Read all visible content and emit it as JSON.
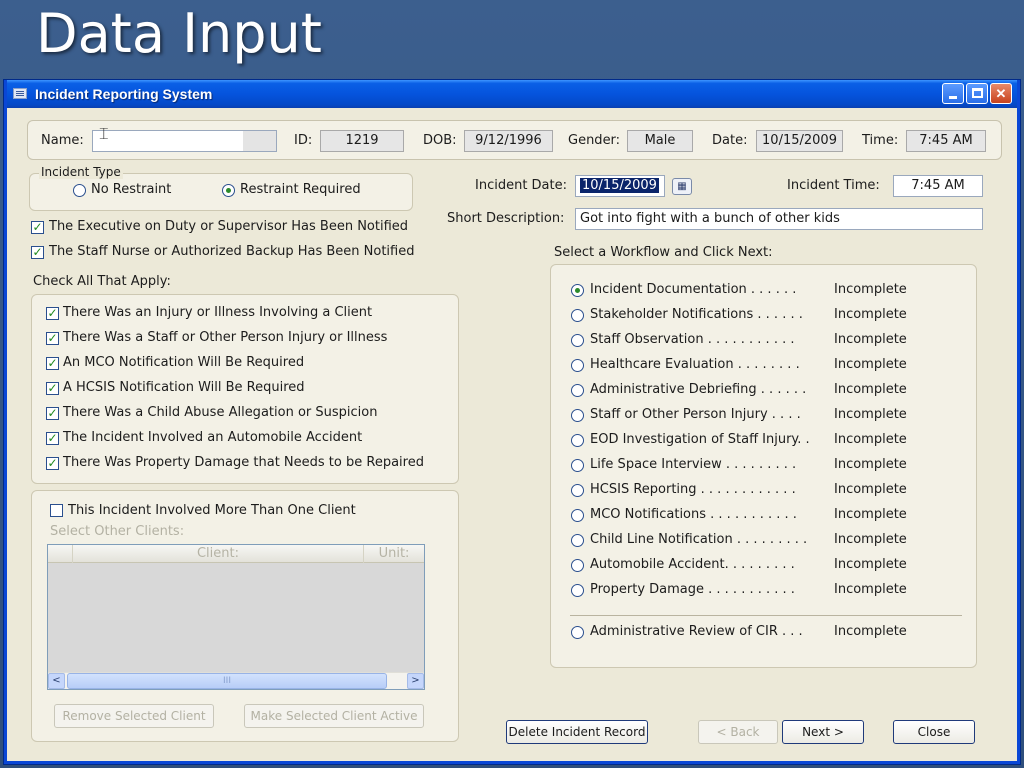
{
  "slide": {
    "title": "Data Input"
  },
  "window": {
    "title": "Incident Reporting System"
  },
  "header": {
    "name_label": "Name:",
    "name_value": "",
    "id_label": "ID:",
    "id_value": "1219",
    "dob_label": "DOB:",
    "dob_value": "9/12/1996",
    "gender_label": "Gender:",
    "gender_value": "Male",
    "date_label": "Date:",
    "date_value": "10/15/2009",
    "time_label": "Time:",
    "time_value": "7:45 AM"
  },
  "incident_type": {
    "legend": "Incident Type",
    "options": [
      {
        "label": "No Restraint",
        "selected": false
      },
      {
        "label": "Restraint Required",
        "selected": true
      }
    ]
  },
  "notifications": [
    {
      "label": "The Executive on Duty or Supervisor Has Been Notified",
      "checked": true
    },
    {
      "label": "The Staff Nurse or Authorized Backup Has Been Notified",
      "checked": true
    }
  ],
  "details": {
    "incident_date_label": "Incident Date:",
    "incident_date_value": "10/15/2009",
    "incident_time_label": "Incident Time:",
    "incident_time_value": "7:45 AM",
    "short_desc_label": "Short Description:",
    "short_desc_value": "Got into fight with a bunch of other kids"
  },
  "check_all": {
    "heading": "Check All That Apply:",
    "items": [
      {
        "label": "There Was an Injury or Illness Involving a Client",
        "checked": true
      },
      {
        "label": "There Was a Staff or Other Person Injury or Illness",
        "checked": true
      },
      {
        "label": "An MCO Notification Will Be Required",
        "checked": true
      },
      {
        "label": "A HCSIS Notification Will Be Required",
        "checked": true
      },
      {
        "label": "There Was a Child Abuse Allegation or Suspicion",
        "checked": true
      },
      {
        "label": "The Incident Involved an Automobile Accident",
        "checked": true
      },
      {
        "label": "There Was Property Damage that Needs to be Repaired",
        "checked": true
      }
    ]
  },
  "clients": {
    "more_than_one_label": "This Incident Involved More Than One Client",
    "more_than_one_checked": false,
    "select_other_label": "Select Other Clients:",
    "columns": [
      "Client:",
      "Unit:"
    ],
    "scroll_left": "<",
    "scroll_right": ">",
    "thumb_grip": "III",
    "remove_button": "Remove Selected Client",
    "make_active_button": "Make Selected Client Active"
  },
  "workflow": {
    "heading": "Select a Workflow and Click Next:",
    "items": [
      {
        "label": "Incident Documentation . . . . . .",
        "status": "Incomplete",
        "selected": true
      },
      {
        "label": "Stakeholder Notifications  . . . . . .",
        "status": "Incomplete",
        "selected": false
      },
      {
        "label": "Staff Observation . . . . . . . . . . .",
        "status": "Incomplete",
        "selected": false
      },
      {
        "label": "Healthcare Evaluation . . . . . . . .",
        "status": "Incomplete",
        "selected": false
      },
      {
        "label": "Administrative Debriefing . . . . . .",
        "status": "Incomplete",
        "selected": false
      },
      {
        "label": "Staff or Other Person Injury . . . .",
        "status": "Incomplete",
        "selected": false
      },
      {
        "label": "EOD Investigation of Staff Injury. .",
        "status": "Incomplete",
        "selected": false
      },
      {
        "label": "Life Space Interview . . . . . . . . .",
        "status": "Incomplete",
        "selected": false
      },
      {
        "label": "HCSIS Reporting . . . . . . . . . . . .",
        "status": "Incomplete",
        "selected": false
      },
      {
        "label": "MCO Notifications  . . . . . . . . . . .",
        "status": "Incomplete",
        "selected": false
      },
      {
        "label": "Child Line Notification . . . . . . . . .",
        "status": "Incomplete",
        "selected": false
      },
      {
        "label": "Automobile Accident. . . . . . . . .",
        "status": "Incomplete",
        "selected": false
      },
      {
        "label": "Property Damage . . . . . . . . . . .",
        "status": "Incomplete",
        "selected": false
      }
    ],
    "review": {
      "label": "Administrative Review of CIR . . .",
      "status": "Incomplete",
      "selected": false
    }
  },
  "footer": {
    "delete_button": "Delete Incident Record",
    "back_button": "< Back",
    "next_button": "Next >",
    "close_button": "Close"
  }
}
